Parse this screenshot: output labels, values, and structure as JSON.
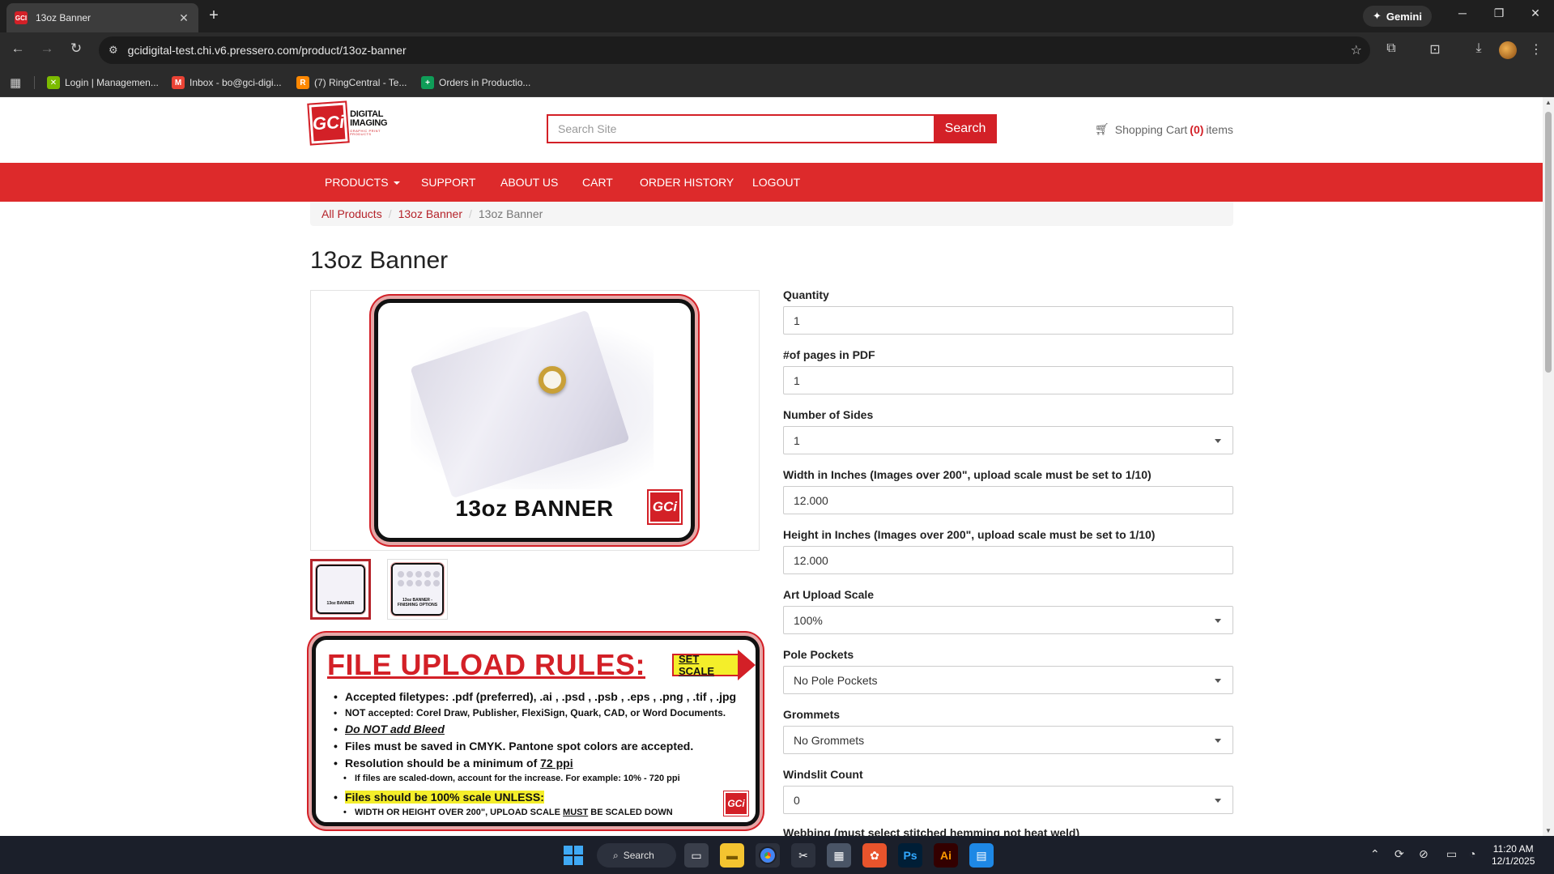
{
  "browser": {
    "tab_title": "13oz Banner",
    "tab_favicon_text": "GCI",
    "close_glyph": "✕",
    "new_tab_glyph": "+",
    "gemini_label": "Gemini",
    "url": "gcidigital-test.chi.v6.pressero.com/product/13oz-banner",
    "bookmarks": [
      {
        "label": "Login | Managemen...",
        "color": "#7cbb00"
      },
      {
        "label": "Inbox - bo@gci-digi...",
        "color": "#ea4335"
      },
      {
        "label": "(7) RingCentral - Te...",
        "color": "#ff8800"
      },
      {
        "label": "Orders in Productio...",
        "color": "#0f9d58"
      }
    ]
  },
  "site": {
    "logo": {
      "line1": "DIGITAL",
      "line2": "IMAGING",
      "tagline": "GRAPHIC PRINT PRODUCTS",
      "mark": "GCi"
    },
    "search": {
      "placeholder": "Search Site",
      "button_label": "Search"
    },
    "cart": {
      "prefix": "Shopping Cart",
      "count": "(0)",
      "suffix": "items"
    },
    "nav": [
      {
        "label": "PRODUCTS"
      },
      {
        "label": "SUPPORT"
      },
      {
        "label": "ABOUT US"
      },
      {
        "label": "CART"
      },
      {
        "label": "ORDER HISTORY"
      },
      {
        "label": "LOGOUT"
      }
    ],
    "breadcrumb": {
      "items": [
        "All Products",
        "13oz Banner"
      ],
      "current": "13oz Banner",
      "separator": "/"
    }
  },
  "product": {
    "title": "13oz Banner",
    "hero_label": "13oz BANNER",
    "badge": "GCi",
    "thumbnails": [
      {
        "label": "13oz BANNER"
      },
      {
        "label": "13oz BANNER - FINISHING OPTIONS"
      }
    ],
    "rules": {
      "title": "FILE UPLOAD RULES:",
      "set_scale": "SET SCALE",
      "filetypes": "Accepted filetypes: .pdf (preferred), .ai , .psd , .psb , .eps , .png , .tif , .jpg",
      "not_accepted": "NOT accepted: Corel Draw, Publisher, FlexiSign, Quark, CAD, or Word Documents.",
      "bleed": "Do NOT add Bleed",
      "cmyk": "Files must be saved in CMYK.  Pantone spot colors are accepted.",
      "resolution_prefix": "Resolution should be a minimum of ",
      "resolution_value": "72 ppi",
      "scaled_note": "If files are scaled-down, account for the increase. For example: 10% - 720 ppi",
      "scale_rule": "Files should be 100% scale UNLESS:",
      "scale_exception_prefix": "WIDTH OR HEIGHT OVER 200\", UPLOAD SCALE ",
      "scale_exception_must": "MUST",
      "scale_exception_suffix": " BE SCALED DOWN"
    }
  },
  "form": {
    "quantity": {
      "label": "Quantity",
      "value": "1"
    },
    "pages": {
      "label": "#of pages in PDF",
      "value": "1"
    },
    "sides": {
      "label": "Number of Sides",
      "value": "1"
    },
    "width": {
      "label": "Width in Inches (Images over 200\", upload scale must be set to 1/10)",
      "value": "12.000"
    },
    "height": {
      "label": "Height in Inches (Images over 200\", upload scale must be set to 1/10)",
      "value": "12.000"
    },
    "scale": {
      "label": "Art Upload Scale",
      "value": "100%"
    },
    "pole_pockets": {
      "label": "Pole Pockets",
      "value": "No Pole Pockets"
    },
    "grommets": {
      "label": "Grommets",
      "value": "No Grommets"
    },
    "windslit": {
      "label": "Windslit Count",
      "value": "0"
    },
    "webbing": {
      "label": "Webbing (must select stitched hemming not heat weld)"
    }
  },
  "taskbar": {
    "search_label": "Search",
    "time": "11:20 AM",
    "date": "12/1/2025",
    "apps": [
      {
        "name": "photoshop",
        "text": "Ps",
        "color": "#001e36",
        "fg": "#31a8ff"
      },
      {
        "name": "illustrator",
        "text": "Ai",
        "color": "#330000",
        "fg": "#ff9a00"
      }
    ]
  },
  "colors": {
    "brand_red": "#dd2a2b",
    "link_red": "#b5232a",
    "highlight_yellow": "#f4ee2a"
  }
}
